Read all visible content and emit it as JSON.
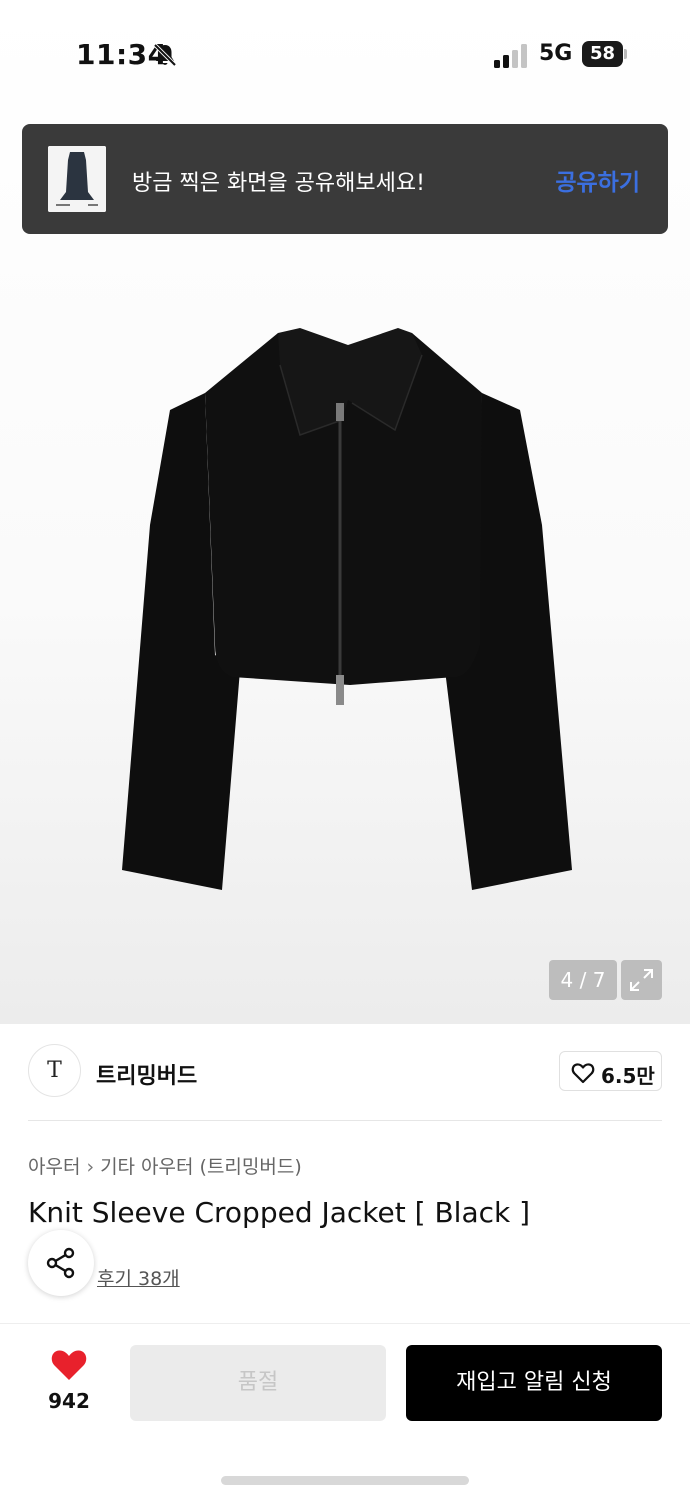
{
  "status_bar": {
    "time": "11:34",
    "network": "5G",
    "battery": "58",
    "icons": [
      "bell-slash-icon",
      "signal-icon",
      "battery-icon"
    ]
  },
  "share_banner": {
    "text": "방금 찍은 화면을 공유해보세요!",
    "action": "공유하기",
    "action_color": "#3b6fe0"
  },
  "gallery": {
    "counter": "4 / 7",
    "expand_icon": "expand-icon"
  },
  "brand": {
    "logo_text": "T",
    "name": "트리밍버드"
  },
  "likes": {
    "count": "6.5만",
    "icon": "heart-outline-icon"
  },
  "product": {
    "breadcrumb": [
      "아우터",
      "기타 아우터 (트리밍버드)"
    ],
    "title": "Knit Sleeve Cropped Jacket [ Black ]",
    "reviews": "후기 38개"
  },
  "bottom_bar": {
    "wish_count": "942",
    "wish_icon": "heart-filled-icon",
    "wish_color": "#e8212c",
    "soldout_label": "품절",
    "restock_label": "재입고 알림 신청"
  }
}
